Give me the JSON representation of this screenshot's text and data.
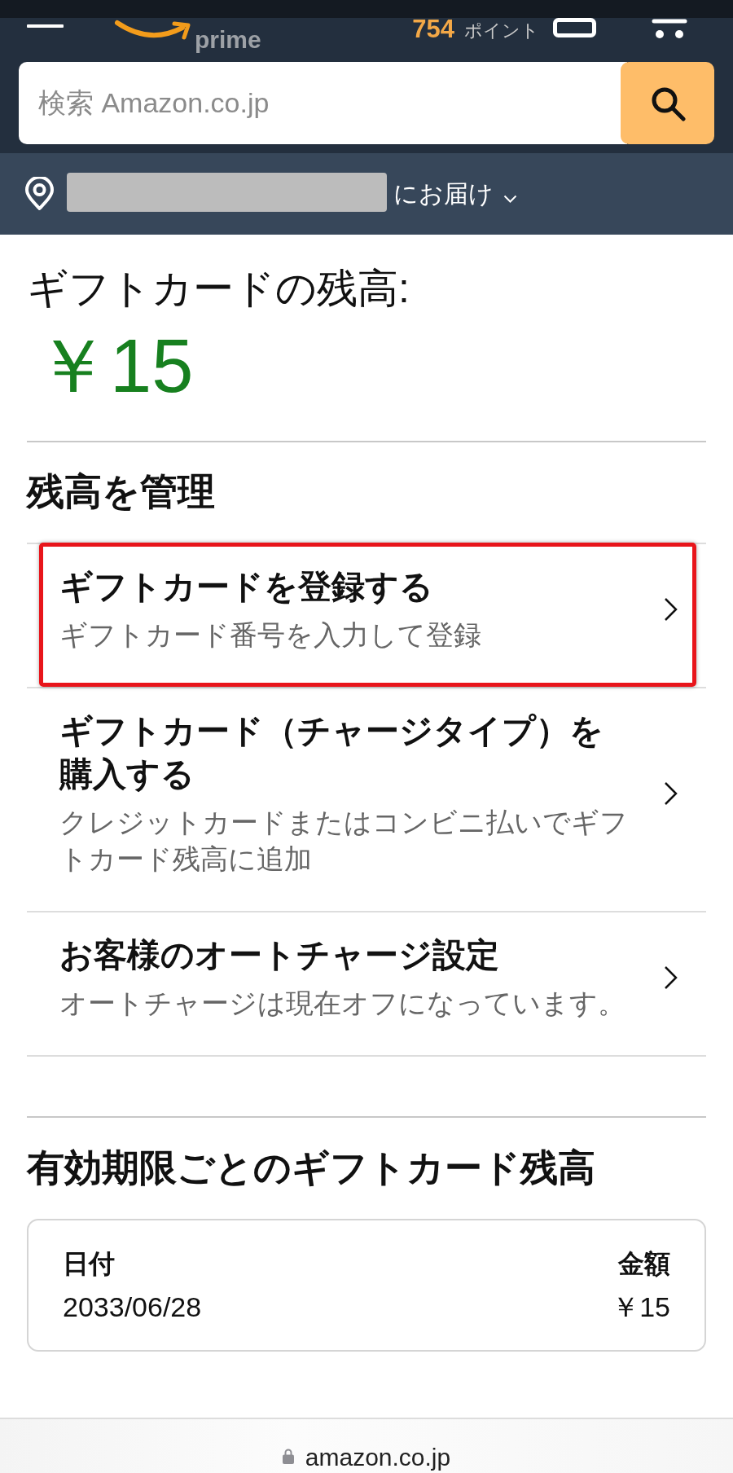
{
  "header": {
    "logo_text": "prime",
    "points": {
      "value": "754",
      "label": "ポイント"
    },
    "search": {
      "placeholder": "検索 Amazon.co.jp"
    }
  },
  "delivery": {
    "label": "にお届け"
  },
  "balance": {
    "title": "ギフトカードの残高:",
    "amount": "￥15"
  },
  "manage": {
    "heading": "残高を管理",
    "items": [
      {
        "title": "ギフトカードを登録する",
        "subtitle": "ギフトカード番号を入力して登録",
        "highlighted": true
      },
      {
        "title": "ギフトカード（チャージタイプ）を購入する",
        "subtitle": "クレジットカードまたはコンビニ払いでギフトカード残高に追加",
        "highlighted": false
      },
      {
        "title": "お客様のオートチャージ設定",
        "subtitle": "オートチャージは現在オフになっています。",
        "highlighted": false
      }
    ]
  },
  "expiry": {
    "heading": "有効期限ごとのギフトカード残高",
    "table": {
      "columns": [
        "日付",
        "金額"
      ],
      "rows": [
        [
          "2033/06/28",
          "￥15"
        ]
      ]
    }
  },
  "browser_bar": {
    "url": "amazon.co.jp"
  }
}
